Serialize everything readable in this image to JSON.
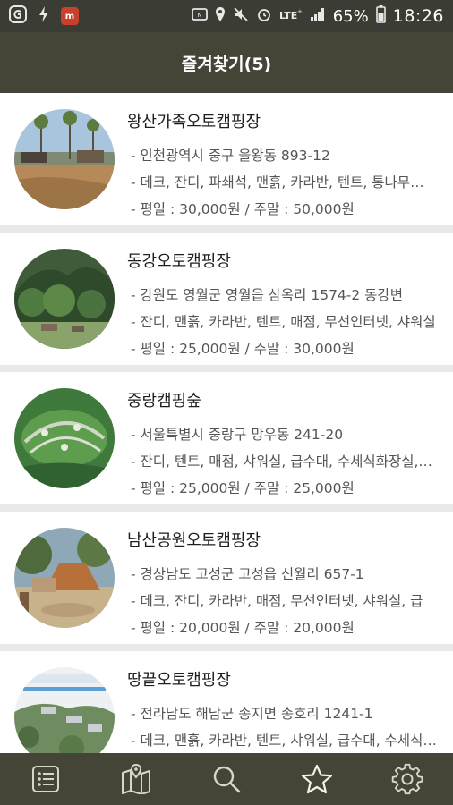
{
  "status_bar": {
    "battery": "65%",
    "time": "18:26",
    "app_badge": "m"
  },
  "header": {
    "title": "즐겨찾기(5)"
  },
  "favorites": [
    {
      "name": "왕산가족오토캠핑장",
      "address": "- 인천광역시 중구 을왕동 893-12",
      "facilities": "- 데크, 잔디, 파쇄석, 맨흙, 카라반, 텐트, 통나무…",
      "price": "- 평일 : 30,000원 / 주말 : 50,000원"
    },
    {
      "name": "동강오토캠핑장",
      "address": "- 강원도 영월군 영월읍 삼옥리 1574-2 동강변",
      "facilities": "- 잔디, 맨흙, 카라반, 텐트, 매점, 무선인터넷, 샤워실",
      "price": "- 평일 : 25,000원 / 주말 : 30,000원"
    },
    {
      "name": "중랑캠핑숲",
      "address": "- 서울특별시 중랑구 망우동 241-20",
      "facilities": "- 잔디, 텐트, 매점, 샤워실, 급수대, 수세식화장실,…",
      "price": "- 평일 : 25,000원 / 주말 : 25,000원"
    },
    {
      "name": "남산공원오토캠핑장",
      "address": "- 경상남도 고성군 고성읍 신월리 657-1",
      "facilities": "- 데크, 잔디, 카라반, 매점, 무선인터넷, 샤워실, 급",
      "price": "- 평일 : 20,000원 / 주말 : 20,000원"
    },
    {
      "name": "땅끝오토캠핑장",
      "address": "- 전라남도 해남군 송지면 송호리 1241-1",
      "facilities": "- 데크, 맨흙, 카라반, 텐트, 샤워실, 급수대, 수세식…",
      "price": ""
    }
  ],
  "bottom_nav": [
    {
      "icon": "list-icon",
      "active": false
    },
    {
      "icon": "map-icon",
      "active": false
    },
    {
      "icon": "search-icon",
      "active": false
    },
    {
      "icon": "star-icon",
      "active": true
    },
    {
      "icon": "gear-icon",
      "active": false
    }
  ],
  "colors": {
    "header_bg": "#444536",
    "status_bg": "#3b3d35",
    "list_bg": "#e9e9e9",
    "card_bg": "#ffffff",
    "title_text": "#ffffff",
    "nav_icon": "#d6d6cc"
  }
}
